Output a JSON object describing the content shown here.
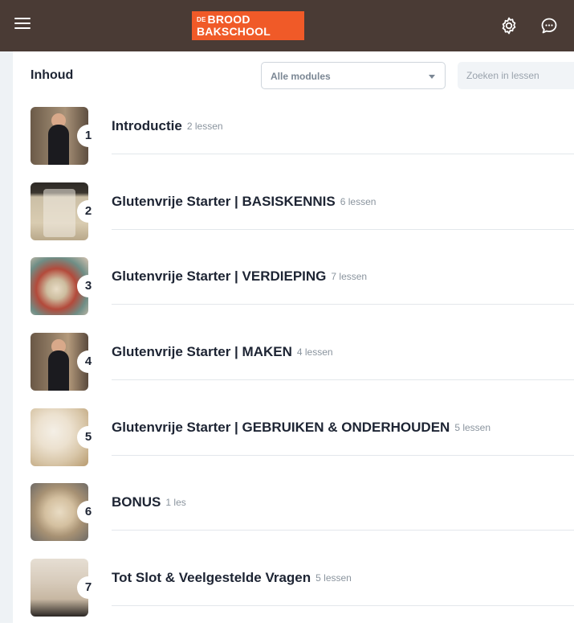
{
  "header": {
    "logo_top_small": "DE",
    "logo_top": "BROOD",
    "logo_bottom": "BAKSCHOOL",
    "menu_icon": "hamburger-menu-icon",
    "settings_icon": "gear-icon",
    "chat_icon": "chat-bubble-icon"
  },
  "content": {
    "heading": "Inhoud",
    "filter_value": "Alle modules",
    "search_placeholder": "Zoeken in lessen"
  },
  "modules": [
    {
      "number": "1",
      "title": "Introductie",
      "count": "2 lessen"
    },
    {
      "number": "2",
      "title": "Glutenvrije Starter | BASISKENNIS",
      "count": "6 lessen"
    },
    {
      "number": "3",
      "title": "Glutenvrije Starter | VERDIEPING",
      "count": "7 lessen"
    },
    {
      "number": "4",
      "title": "Glutenvrije Starter | MAKEN",
      "count": "4 lessen"
    },
    {
      "number": "5",
      "title": "Glutenvrije Starter | GEBRUIKEN & ONDERHOUDEN",
      "count": "5 lessen"
    },
    {
      "number": "6",
      "title": "BONUS",
      "count": "1 les"
    },
    {
      "number": "7",
      "title": "Tot Slot & Veelgestelde Vragen",
      "count": "5 lessen"
    }
  ],
  "colors": {
    "topbar": "#4a3b35",
    "logo": "#f05a28",
    "title_text": "#1d2433",
    "muted_text": "#8a949e"
  }
}
